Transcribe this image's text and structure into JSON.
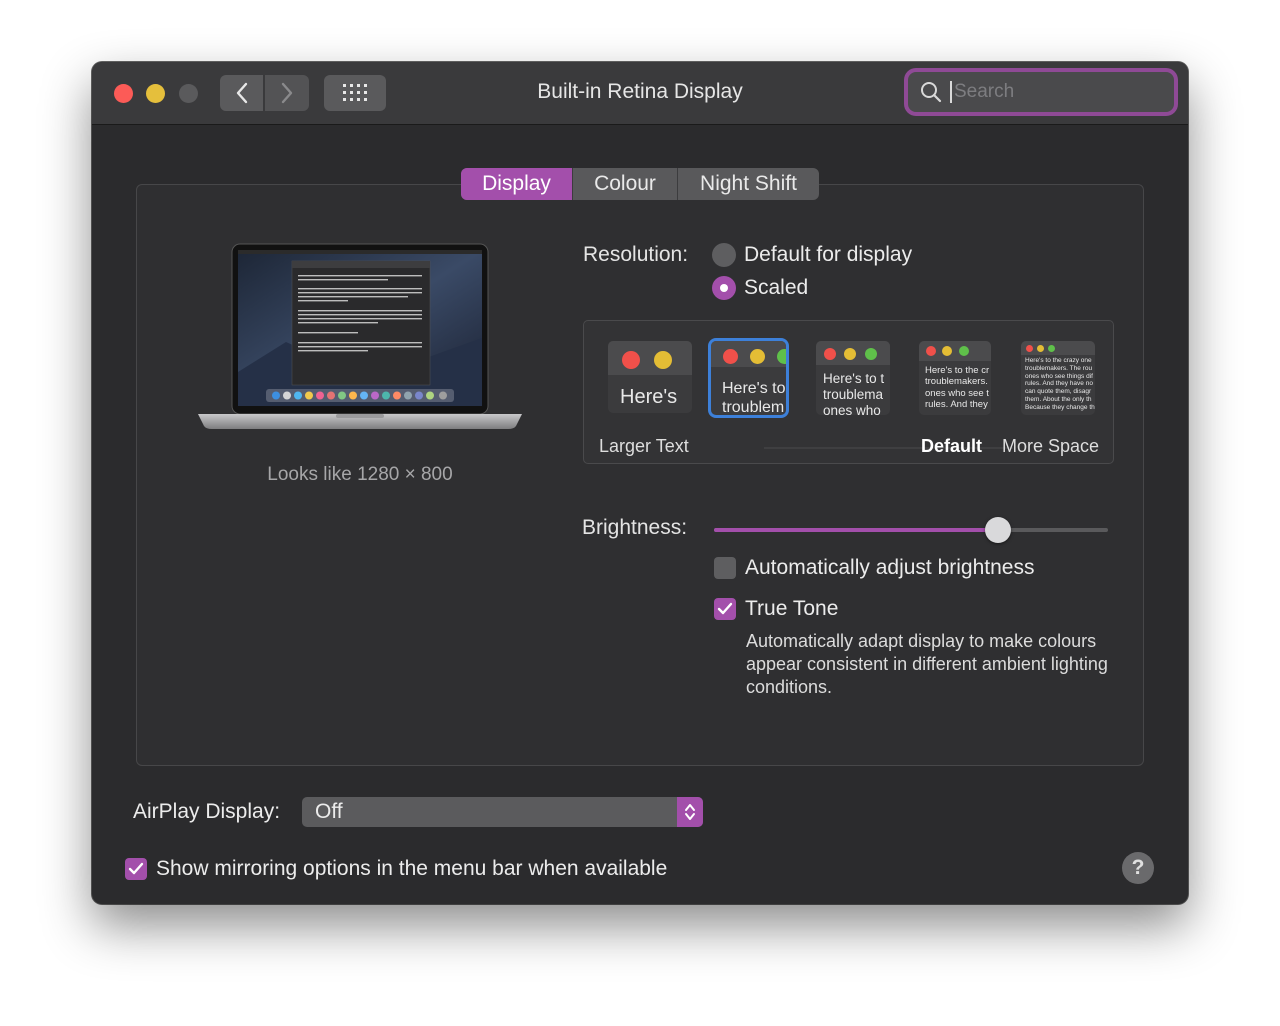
{
  "window": {
    "title": "Built-in Retina Display",
    "search_placeholder": "Search"
  },
  "tabs": [
    {
      "label": "Display",
      "active": true
    },
    {
      "label": "Colour",
      "active": false
    },
    {
      "label": "Night Shift",
      "active": false
    }
  ],
  "display_preview": {
    "looks_like": "Looks like 1280 × 800"
  },
  "resolution": {
    "label": "Resolution:",
    "options": [
      {
        "label": "Default for display",
        "selected": false
      },
      {
        "label": "Scaled",
        "selected": true
      }
    ]
  },
  "scaled_options": {
    "thumbnails": [
      {
        "text": "Here's",
        "selected": false
      },
      {
        "text": "Here's to\ntroublem",
        "selected": true
      },
      {
        "text": "Here's to t\ntroublema\nones who",
        "selected": false
      },
      {
        "text": "Here's to the cr\ntroublemakers.\nones who see t\nrules. And they",
        "selected": false
      },
      {
        "text": "Here's to the crazy one\ntroublemakers. The rou\nones who see things dif\nrules. And they have no\ncan quote them, disagr\nthem. About the only th\nBecause they change th",
        "selected": false
      }
    ],
    "labels": {
      "larger": "Larger Text",
      "default": "Default",
      "more": "More Space"
    }
  },
  "brightness": {
    "label": "Brightness:",
    "level": 0.72
  },
  "auto_brightness": {
    "label": "Automatically adjust brightness",
    "checked": false
  },
  "true_tone": {
    "label": "True Tone",
    "checked": true,
    "description": "Automatically adapt display to make colours appear consistent in different ambient lighting conditions."
  },
  "airplay": {
    "label": "AirPlay Display:",
    "value": "Off"
  },
  "mirroring": {
    "label": "Show mirroring options in the menu bar when available",
    "checked": true
  },
  "help": {
    "symbol": "?"
  },
  "colors": {
    "accent": "#a34fab",
    "window_bg": "#2b2b2d",
    "selection_ring": "#3d80d9"
  }
}
